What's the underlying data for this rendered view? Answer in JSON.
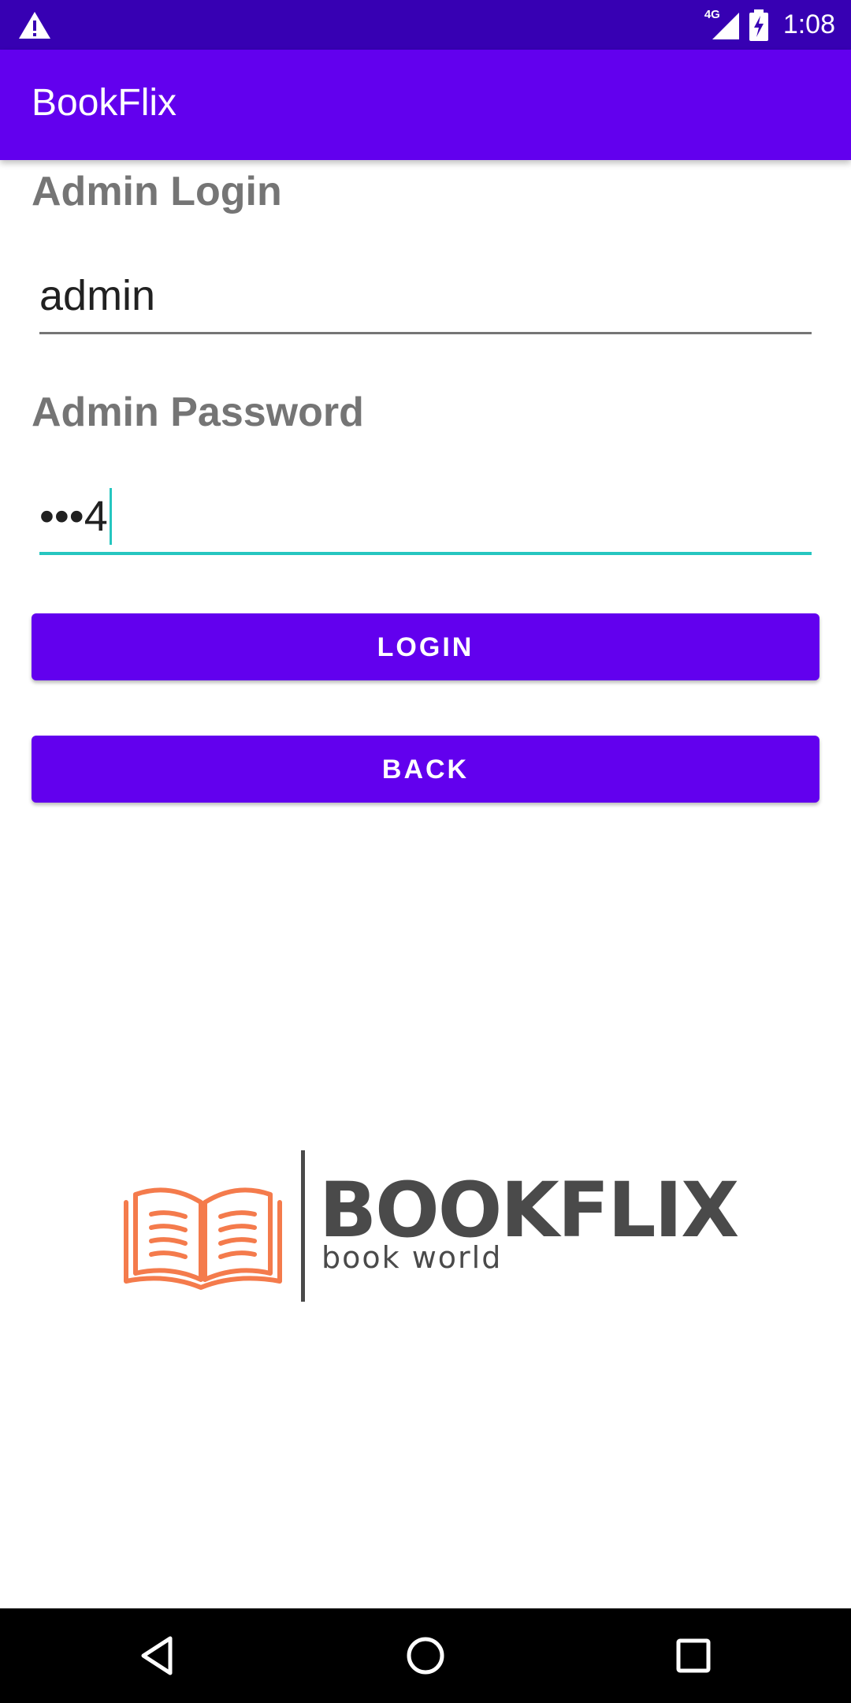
{
  "status_bar": {
    "network": "4G",
    "time": "1:08",
    "icons": [
      "warning-icon",
      "signal-icon",
      "battery-charging-icon"
    ]
  },
  "app_bar": {
    "title": "BookFlix"
  },
  "form": {
    "login_label": "Admin Login",
    "login_value": "admin",
    "password_label": "Admin Password",
    "password_display": "•••4"
  },
  "buttons": {
    "login": "LOGIN",
    "back": "BACK"
  },
  "logo": {
    "brand": "BOOKFLIX",
    "tagline": "book world",
    "icon": "open-book-icon"
  },
  "nav_bar": {
    "icons": [
      "back-triangle-icon",
      "home-circle-icon",
      "recents-square-icon"
    ]
  },
  "colors": {
    "status_bar": "#3700b3",
    "primary": "#6200ee",
    "accent": "#26c6c0",
    "label_gray": "#757575",
    "logo_orange": "#f47b4c"
  }
}
